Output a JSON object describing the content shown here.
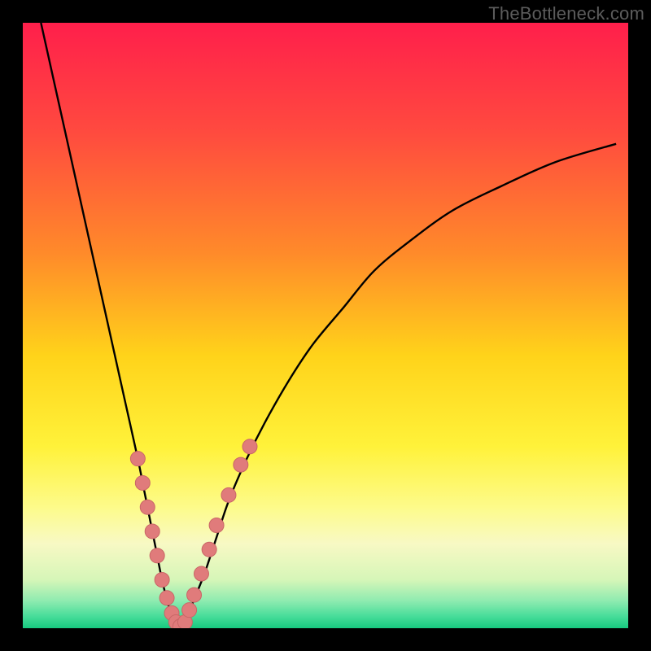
{
  "attribution": "TheBottleneck.com",
  "colors": {
    "frame": "#000000",
    "curve": "#000000",
    "marker_fill": "#e07b7b",
    "marker_stroke": "#c96666",
    "gradient_stops": [
      {
        "offset": 0.0,
        "color": "#ff1f4b"
      },
      {
        "offset": 0.18,
        "color": "#ff4a3f"
      },
      {
        "offset": 0.38,
        "color": "#ff8a2a"
      },
      {
        "offset": 0.55,
        "color": "#ffd31a"
      },
      {
        "offset": 0.7,
        "color": "#fff23a"
      },
      {
        "offset": 0.8,
        "color": "#fdfb8a"
      },
      {
        "offset": 0.86,
        "color": "#f8f9c4"
      },
      {
        "offset": 0.92,
        "color": "#d6f6b8"
      },
      {
        "offset": 0.955,
        "color": "#8eebb0"
      },
      {
        "offset": 0.98,
        "color": "#48dd9a"
      },
      {
        "offset": 1.0,
        "color": "#17c97f"
      }
    ]
  },
  "chart_data": {
    "type": "line",
    "title": "",
    "xlabel": "",
    "ylabel": "",
    "xlim": [
      0,
      100
    ],
    "ylim": [
      0,
      100
    ],
    "grid": false,
    "series": [
      {
        "name": "bottleneck-curve",
        "x": [
          3,
          5,
          7,
          9,
          11,
          13,
          15,
          17,
          19,
          20,
          21,
          22,
          23,
          24,
          25,
          26,
          27,
          28,
          30,
          32,
          34,
          37,
          40,
          44,
          48,
          53,
          58,
          64,
          71,
          79,
          88,
          98
        ],
        "y": [
          100,
          91,
          82,
          73,
          64,
          55,
          46,
          37,
          28,
          23,
          18,
          13,
          8,
          4,
          1,
          0,
          1,
          4,
          9,
          15,
          21,
          28,
          34,
          41,
          47,
          53,
          59,
          64,
          69,
          73,
          77,
          80
        ]
      }
    ],
    "markers": {
      "name": "highlight-points",
      "points": [
        {
          "x": 19.0,
          "y": 28
        },
        {
          "x": 19.8,
          "y": 24
        },
        {
          "x": 20.6,
          "y": 20
        },
        {
          "x": 21.4,
          "y": 16
        },
        {
          "x": 22.2,
          "y": 12
        },
        {
          "x": 23.0,
          "y": 8
        },
        {
          "x": 23.8,
          "y": 5
        },
        {
          "x": 24.6,
          "y": 2.5
        },
        {
          "x": 25.3,
          "y": 1
        },
        {
          "x": 26.0,
          "y": 0.3
        },
        {
          "x": 26.8,
          "y": 1
        },
        {
          "x": 27.5,
          "y": 3
        },
        {
          "x": 28.3,
          "y": 5.5
        },
        {
          "x": 29.5,
          "y": 9
        },
        {
          "x": 30.8,
          "y": 13
        },
        {
          "x": 32.0,
          "y": 17
        },
        {
          "x": 34.0,
          "y": 22
        },
        {
          "x": 36.0,
          "y": 27
        },
        {
          "x": 37.5,
          "y": 30
        }
      ],
      "radius": 9
    }
  }
}
